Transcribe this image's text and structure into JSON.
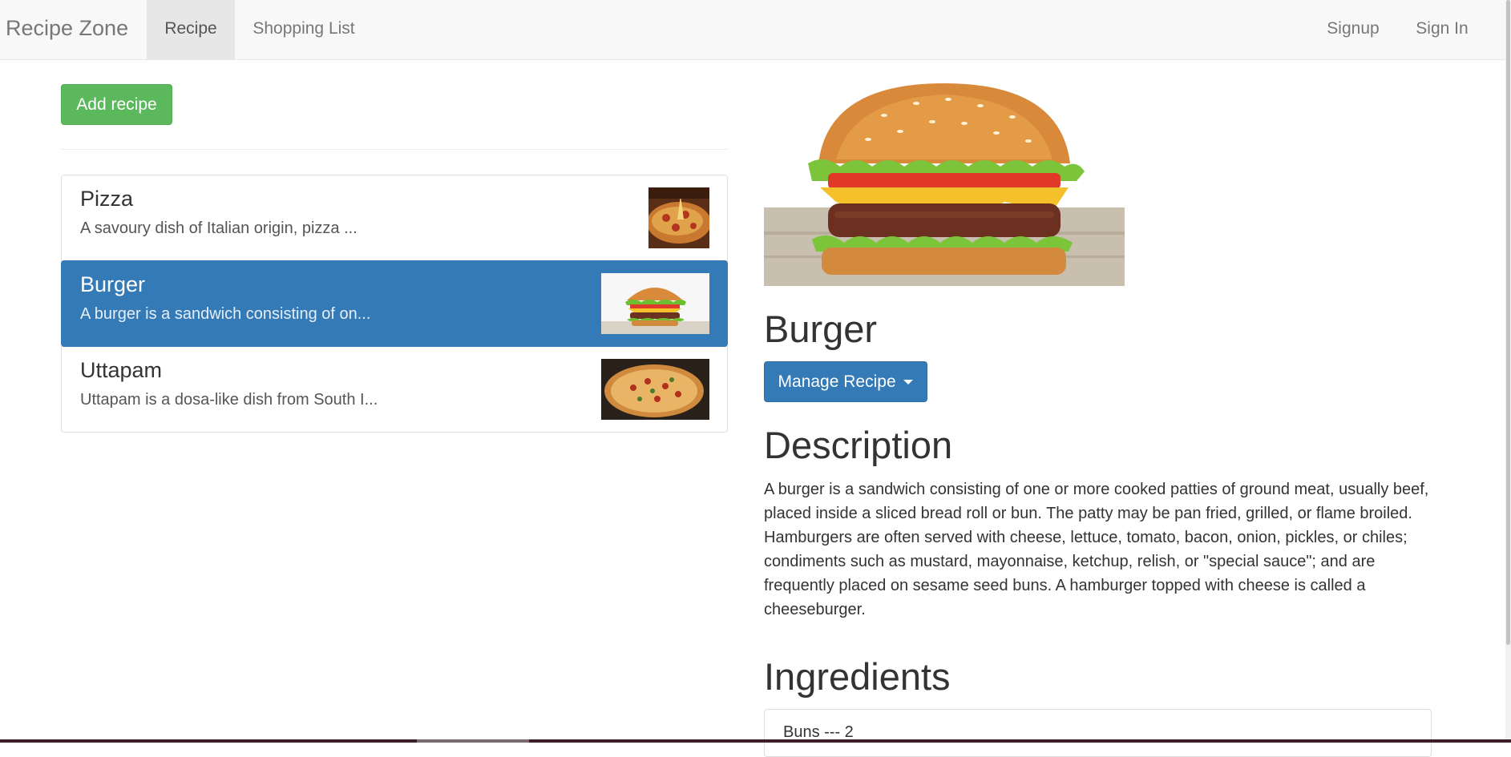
{
  "navbar": {
    "brand": "Recipe Zone",
    "links": [
      {
        "label": "Recipe",
        "active": true
      },
      {
        "label": "Shopping List",
        "active": false
      }
    ],
    "right_links": [
      {
        "label": "Signup"
      },
      {
        "label": "Sign In"
      }
    ]
  },
  "recipes_panel": {
    "add_button_label": "Add recipe",
    "items": [
      {
        "name": "Pizza",
        "summary": "A savoury dish of Italian origin, pizza ...",
        "selected": false,
        "image": "pizza-photo"
      },
      {
        "name": "Burger",
        "summary": "A burger is a sandwich consisting of on...",
        "selected": true,
        "image": "burger-photo"
      },
      {
        "name": "Uttapam",
        "summary": "Uttapam is a dosa-like dish from South I...",
        "selected": false,
        "image": "uttapam-photo"
      }
    ]
  },
  "detail": {
    "image": "burger-photo",
    "title": "Burger",
    "manage_button_label": "Manage Recipe",
    "description_heading": "Description",
    "description": "A burger is a sandwich consisting of one or more cooked patties of ground meat, usually beef, placed inside a sliced bread roll or bun. The patty may be pan fried, grilled, or flame broiled. Hamburgers are often served with cheese, lettuce, tomato, bacon, onion, pickles, or chiles; condiments such as mustard, mayonnaise, ketchup, relish, or \"special sauce\"; and are frequently placed on sesame seed buns. A hamburger topped with cheese is called a cheeseburger.",
    "ingredients_heading": "Ingredients",
    "ingredients": [
      {
        "text": "Buns --- 2"
      }
    ]
  },
  "colors": {
    "success": "#5cb85c",
    "primary": "#337ab7",
    "navbar_bg": "#f8f8f8"
  }
}
